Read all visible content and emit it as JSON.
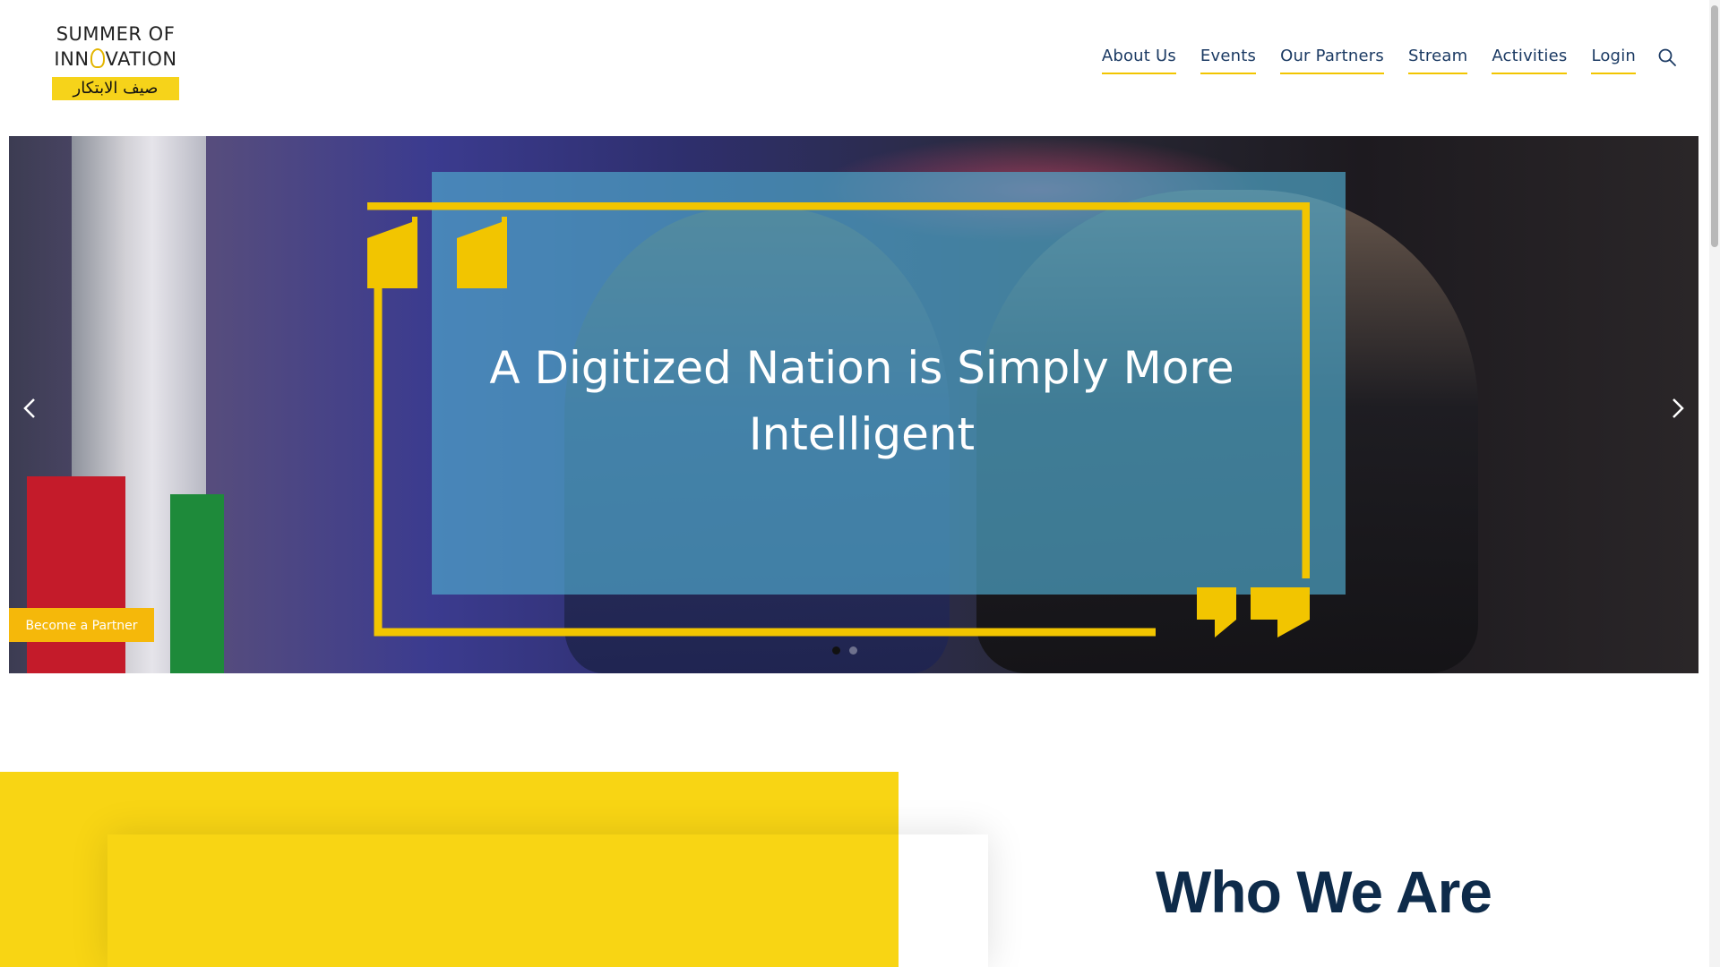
{
  "logo": {
    "line1": "SUMMER OF",
    "line2_a": "INN",
    "line2_b": "VATION",
    "arabic": "صيف الابتكار"
  },
  "nav": {
    "items": [
      {
        "label": "About Us"
      },
      {
        "label": "Events"
      },
      {
        "label": "Our Partners"
      },
      {
        "label": "Stream"
      },
      {
        "label": "Activities"
      },
      {
        "label": "Login"
      }
    ],
    "search_icon": "search-icon",
    "link_color": "#1b3a63",
    "underline_color": "#f2c500"
  },
  "hero": {
    "title": "A Digitized Nation is Simply More Intelligent",
    "prev_icon": "chevron-left-icon",
    "next_icon": "chevron-right-icon",
    "slides_total": 2,
    "active_slide": 1,
    "accent_color": "#f2c500",
    "overlay_color": "#50aacd"
  },
  "partner_button": {
    "label": "Become a Partner"
  },
  "about": {
    "title": "Who We Are"
  }
}
